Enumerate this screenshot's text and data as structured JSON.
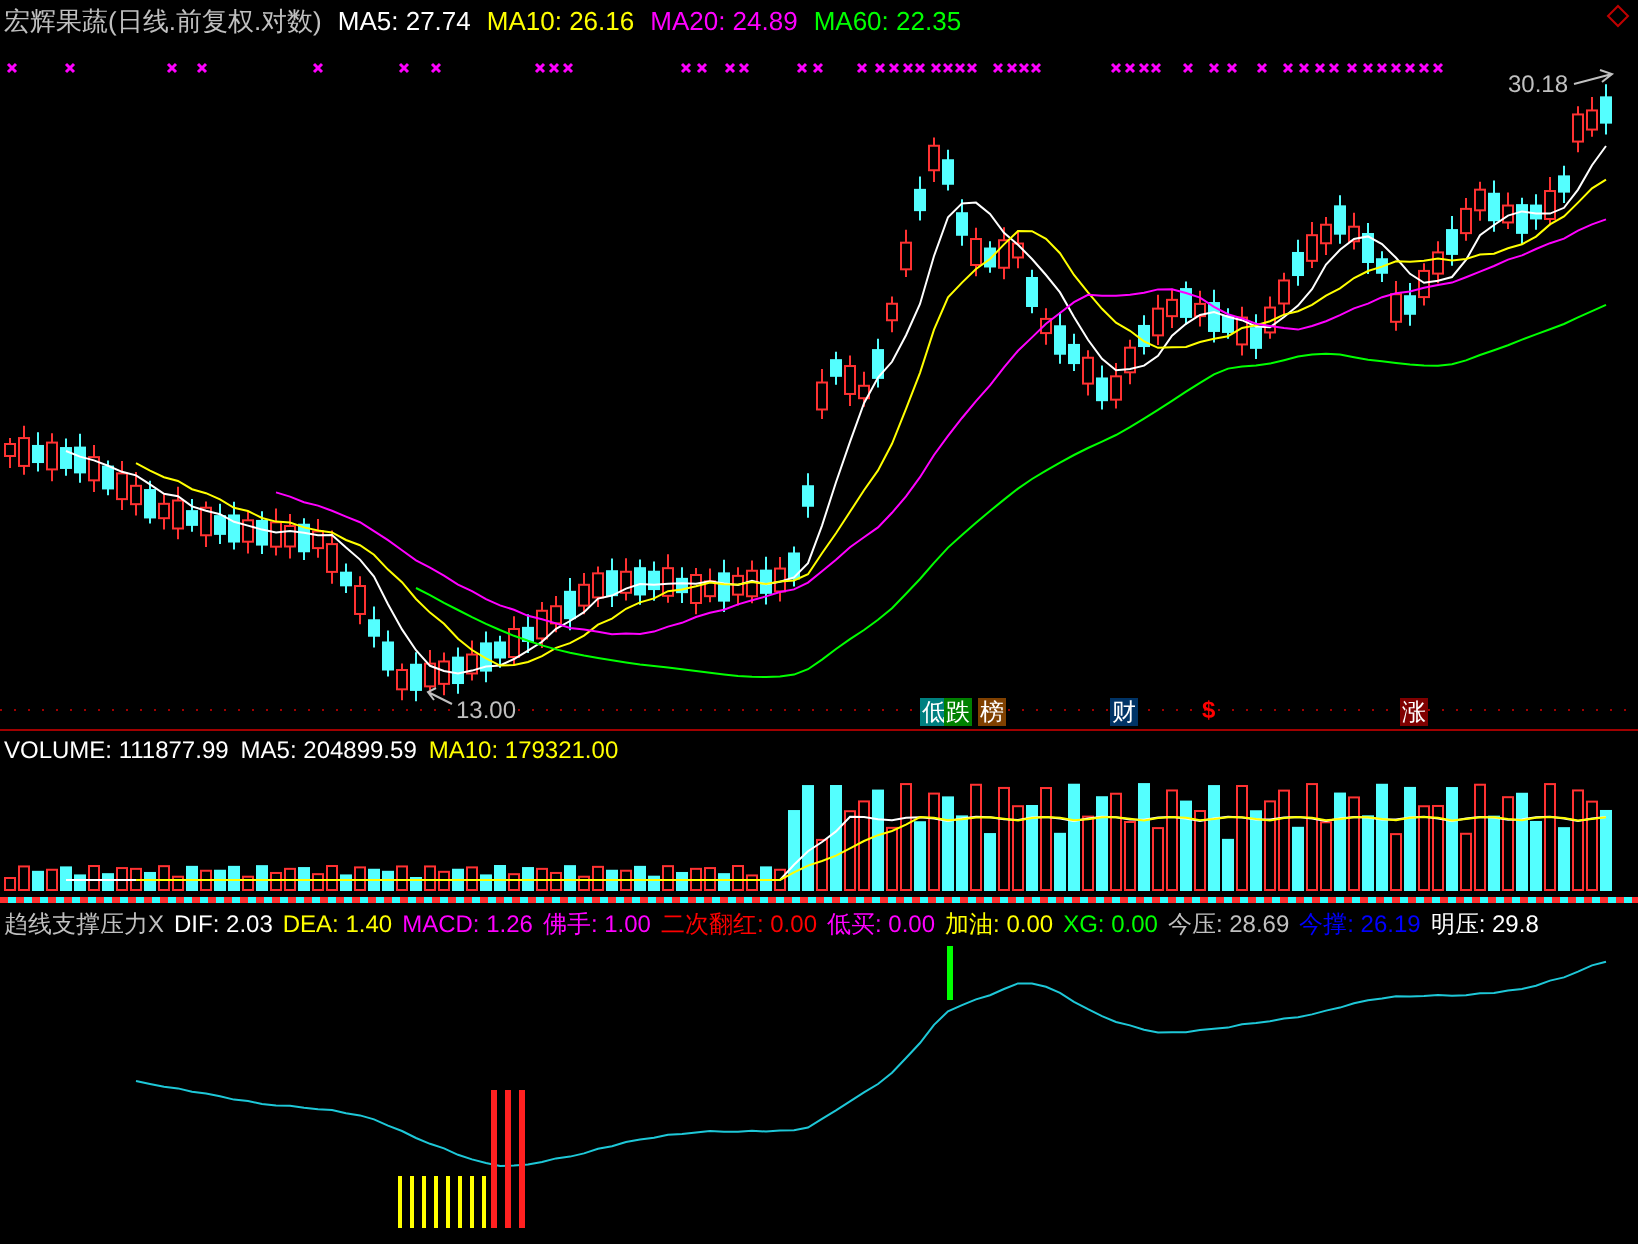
{
  "price_panel": {
    "title": "宏辉果蔬(日线.前复权.对数)",
    "legend": [
      {
        "label": "MA5: 27.74",
        "color": "#ffffff"
      },
      {
        "label": "MA10: 26.16",
        "color": "#ffff00"
      },
      {
        "label": "MA20: 24.89",
        "color": "#ff00ff"
      },
      {
        "label": "MA60: 22.35",
        "color": "#00ff00"
      }
    ],
    "high_label": "30.18",
    "low_label": "13.00",
    "badges": [
      {
        "kind": "tag",
        "text": "低",
        "color": "#008080"
      },
      {
        "kind": "tag",
        "text": "跌",
        "color": "#008000"
      },
      {
        "kind": "tag",
        "text": "榜",
        "color": "#804000"
      },
      {
        "kind": "tag",
        "text": "财",
        "color": "#003366"
      },
      {
        "kind": "sign",
        "text": "$",
        "color": "#ff0000"
      },
      {
        "kind": "tag",
        "text": "涨",
        "color": "#800000"
      }
    ]
  },
  "volume_panel": {
    "legend": [
      {
        "label": "VOLUME: 111877.99",
        "color": "#ffffff"
      },
      {
        "label": "MA5: 204899.59",
        "color": "#ffffff"
      },
      {
        "label": "MA10: 179321.00",
        "color": "#ffff00"
      }
    ]
  },
  "indicator_panel": {
    "legend": [
      {
        "label": "趋线支撑压力X",
        "color": "#c0c0c0"
      },
      {
        "label": "DIF: 2.03",
        "color": "#ffffff"
      },
      {
        "label": "DEA: 1.40",
        "color": "#ffff00"
      },
      {
        "label": "MACD: 1.26",
        "color": "#ff00ff"
      },
      {
        "label": "佛手: 1.00",
        "color": "#ff00ff"
      },
      {
        "label": "二次翻红: 0.00",
        "color": "#ff0000"
      },
      {
        "label": "低买: 0.00",
        "color": "#ff00ff"
      },
      {
        "label": "加油: 0.00",
        "color": "#ffff00"
      },
      {
        "label": "XG: 0.00",
        "color": "#00ff00"
      },
      {
        "label": "今压: 28.69",
        "color": "#c0c0c0"
      },
      {
        "label": "今撑: 26.19",
        "color": "#0000ff"
      },
      {
        "label": "明压: 29.8",
        "color": "#ffffff"
      }
    ]
  }
}
